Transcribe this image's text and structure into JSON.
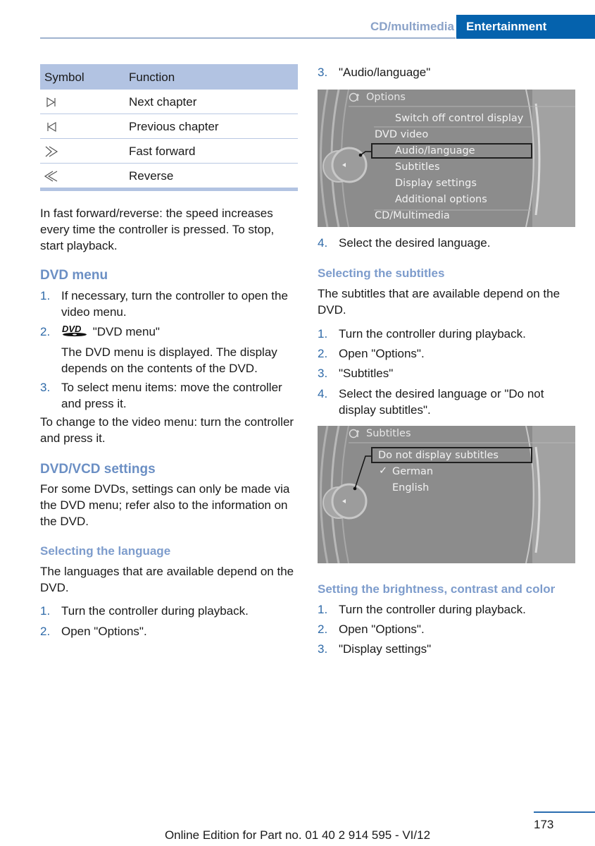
{
  "header": {
    "section": "CD/multimedia",
    "chapter": "Entertainment",
    "chapter_color": "#0562ad"
  },
  "symbol_table": {
    "headers": [
      "Symbol",
      "Function"
    ],
    "rows": [
      {
        "icon": "next-chapter-icon",
        "function": "Next chapter"
      },
      {
        "icon": "previous-chapter-icon",
        "function": "Previous chapter"
      },
      {
        "icon": "fast-forward-icon",
        "function": "Fast forward"
      },
      {
        "icon": "reverse-icon",
        "function": "Reverse"
      }
    ]
  },
  "left": {
    "ff_note": "In fast forward/reverse: the speed increases every time the controller is pressed. To stop, start playback.",
    "dvd_menu": {
      "heading": "DVD menu",
      "steps": [
        {
          "num": "1.",
          "text": "If necessary, turn the controller to open the video menu."
        },
        {
          "num": "2.",
          "icon": "dvd-logo-icon",
          "text": "\"DVD menu\"",
          "note": "The DVD menu is displayed. The display depends on the contents of the DVD."
        },
        {
          "num": "3.",
          "text": "To select menu items: move the controller and press it."
        }
      ],
      "after": "To change to the video menu: turn the controller and press it."
    },
    "settings": {
      "heading": "DVD/VCD settings",
      "text": "For some DVDs, settings can only be made via the DVD menu; refer also to the information on the DVD."
    },
    "language": {
      "heading": "Selecting the language",
      "text": "The languages that are available depend on the DVD.",
      "steps": [
        {
          "num": "1.",
          "text": "Turn the controller during playback."
        },
        {
          "num": "2.",
          "text": "Open \"Options\"."
        }
      ]
    }
  },
  "right": {
    "lang_steps_cont": [
      {
        "num": "3.",
        "text": "\"Audio/language\""
      },
      {
        "num": "4.",
        "text": "Select the desired language."
      }
    ],
    "options_screen": {
      "title": "Options",
      "items": [
        {
          "text": "Switch off control display",
          "indent": true
        },
        {
          "text": "DVD video",
          "indent": false
        },
        {
          "text": "Audio/language",
          "indent": true,
          "selected": true
        },
        {
          "text": "Subtitles",
          "indent": true
        },
        {
          "text": "Display settings",
          "indent": true
        },
        {
          "text": "Additional options",
          "indent": true
        },
        {
          "text": "CD/Multimedia",
          "indent": false
        }
      ]
    },
    "subtitles": {
      "heading": "Selecting the subtitles",
      "text": "The subtitles that are available depend on the DVD.",
      "steps": [
        {
          "num": "1.",
          "text": "Turn the controller during playback."
        },
        {
          "num": "2.",
          "text": "Open \"Options\"."
        },
        {
          "num": "3.",
          "text": "\"Subtitles\""
        },
        {
          "num": "4.",
          "text": "Select the desired language or \"Do not display subtitles\"."
        }
      ]
    },
    "subtitles_screen": {
      "title": "Subtitles",
      "items": [
        {
          "text": "Do not display subtitles",
          "selected": true,
          "checked": false
        },
        {
          "text": "German",
          "checked": true
        },
        {
          "text": "English",
          "checked": false
        }
      ]
    },
    "brightness": {
      "heading": "Setting the brightness, contrast and color",
      "steps": [
        {
          "num": "1.",
          "text": "Turn the controller during playback."
        },
        {
          "num": "2.",
          "text": "Open \"Options\"."
        },
        {
          "num": "3.",
          "text": "\"Display settings\""
        }
      ]
    }
  },
  "footer": {
    "page_number": "173",
    "edition": "Online Edition for Part no. 01 40 2 914 595 - VI/12"
  }
}
